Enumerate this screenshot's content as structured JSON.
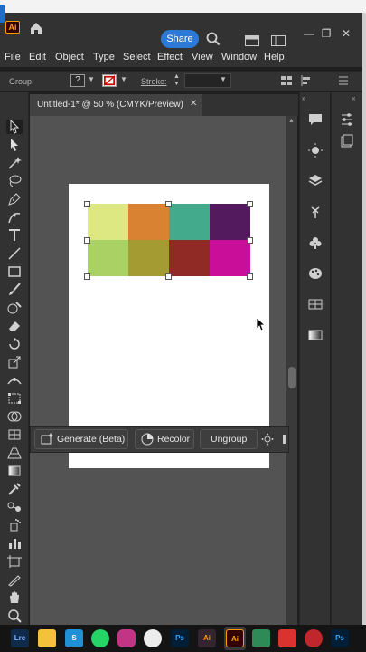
{
  "app": {
    "logo_text": "Ai",
    "share_label": "Share",
    "window_controls": [
      "—",
      "❐",
      "✕"
    ]
  },
  "menu": [
    "File",
    "Edit",
    "Object",
    "Type",
    "Select",
    "Effect",
    "View",
    "Window",
    "Help"
  ],
  "control_bar": {
    "selection_label": "Group",
    "fill_value": "?",
    "stroke_label": "Stroke:"
  },
  "document": {
    "tab_title": "Untitled-1* @ 50 % (CMYK/Preview)",
    "tab_close": "✕"
  },
  "swatches": {
    "row1": [
      "#dde882",
      "#d88232",
      "#44aa8c",
      "#531a5e"
    ],
    "row2": [
      "#aad164",
      "#a49c33",
      "#8f2a24",
      "#c90e9a"
    ]
  },
  "contextual_bar": {
    "generate_label": "Generate (Beta)",
    "recolor_label": "Recolor",
    "ungroup_label": "Ungroup"
  },
  "taskbar": {
    "apps": [
      "Lrc",
      "S",
      "Ps",
      "Ai",
      "Ai",
      "Ps"
    ]
  },
  "colors": {
    "accent": "#2d7ad6",
    "ui_dark": "#323232",
    "canvas": "#535353",
    "illustrator_orange": "#ff9a00"
  }
}
